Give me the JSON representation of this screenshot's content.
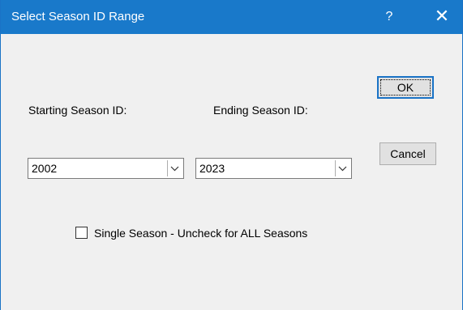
{
  "dialog": {
    "title": "Select Season ID Range",
    "help_glyph": "?",
    "close_glyph": "✕"
  },
  "labels": {
    "starting": "Starting Season ID:",
    "ending": "Ending Season ID:"
  },
  "start_combo": {
    "value": "2002"
  },
  "end_combo": {
    "value": "2023"
  },
  "buttons": {
    "ok": "OK",
    "cancel": "Cancel"
  },
  "single_season": {
    "label": "Single Season - Uncheck for ALL Seasons",
    "checked": false
  },
  "colors": {
    "titlebar": "#1979ca",
    "dialog_bg": "#f0f0f0",
    "accent_border": "#1a73c6"
  },
  "icons": {
    "help": "help-icon",
    "close": "close-icon",
    "dropdown": "chevron-down-icon"
  }
}
